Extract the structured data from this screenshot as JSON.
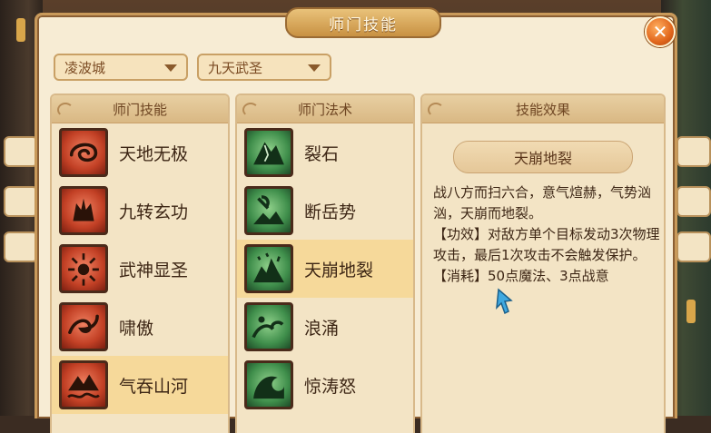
{
  "dialog": {
    "title": "师门技能",
    "close_label": "✕"
  },
  "filters": {
    "city": "凌波城",
    "school": "九天武圣"
  },
  "columns": {
    "skills_header": "师门技能",
    "spells_header": "师门法术",
    "effect_header": "技能效果"
  },
  "skills": [
    {
      "label": "天地无极",
      "icon": "swirl-icon"
    },
    {
      "label": "九转玄功",
      "icon": "fist-icon"
    },
    {
      "label": "武神显圣",
      "icon": "sunburst-icon"
    },
    {
      "label": "啸傲",
      "icon": "dragon-icon"
    },
    {
      "label": "气吞山河",
      "icon": "mountain-wave-icon",
      "selected": true
    }
  ],
  "spells": [
    {
      "label": "裂石",
      "icon": "rock-crack-icon"
    },
    {
      "label": "断岳势",
      "icon": "axe-mountain-icon"
    },
    {
      "label": "天崩地裂",
      "icon": "crumbling-peak-icon",
      "selected": true
    },
    {
      "label": "浪涌",
      "icon": "wave-icon"
    },
    {
      "label": "惊涛怒",
      "icon": "tidal-wave-icon"
    }
  ],
  "effect": {
    "name": "天崩地裂",
    "description": "战八方而扫六合，意气煊赫，气势汹汹，天崩而地裂。",
    "effect_line": "【功效】对敌方单个目标发动3次物理攻击，最后1次攻击不会触发保护。",
    "cost_line": "【消耗】50点魔法、3点战意"
  },
  "colors": {
    "panel_bg": "#f7ecd4",
    "selected_row": "#f6d99a",
    "close_button": "#e1661c"
  }
}
